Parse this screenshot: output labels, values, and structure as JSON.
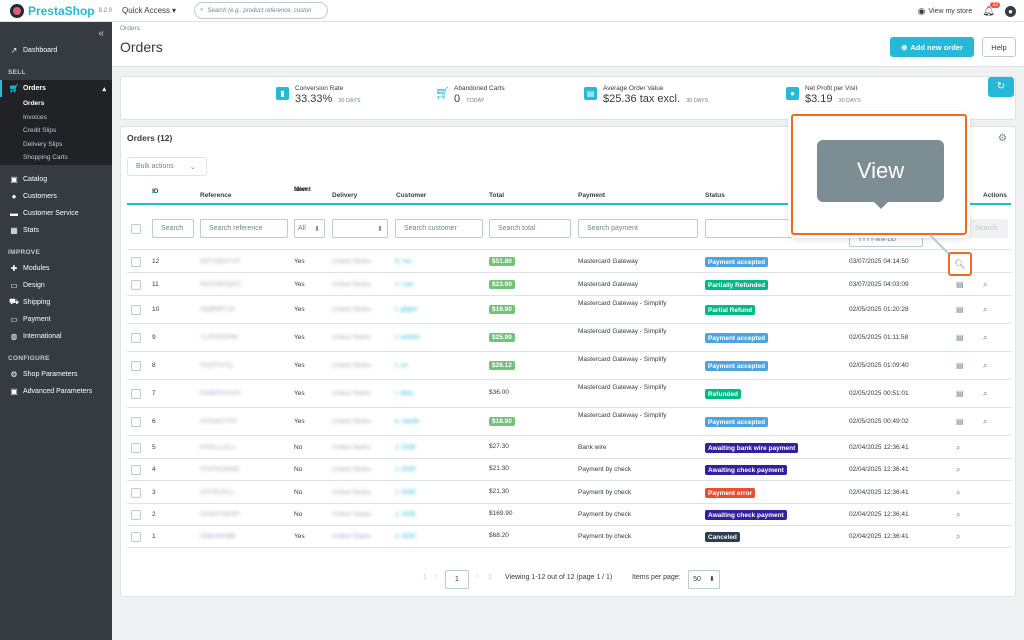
{
  "topbar": {
    "logo_text": "PrestaShop",
    "version": "8.2.0",
    "quick_access": "Quick Access",
    "search_placeholder": "Search (e.g.: product reference, custon",
    "view_store": "View my store",
    "notif_count": "22"
  },
  "sidebar": {
    "collapse_icon": "«",
    "dashboard": "Dashboard",
    "sections": {
      "sell": "SELL",
      "improve": "IMPROVE",
      "configure": "CONFIGURE"
    },
    "orders": "Orders",
    "orders_sub": [
      "Orders",
      "Invoices",
      "Credit Slips",
      "Delivery Slips",
      "Shopping Carts"
    ],
    "sell_items": [
      "Catalog",
      "Customers",
      "Customer Service",
      "Stats"
    ],
    "improve_items": [
      "Modules",
      "Design",
      "Shipping",
      "Payment",
      "International"
    ],
    "configure_items": [
      "Shop Parameters",
      "Advanced Parameters"
    ]
  },
  "header": {
    "breadcrumb": "Orders",
    "title": "Orders",
    "add_button": "Add new order",
    "help_button": "Help"
  },
  "kpis": [
    {
      "label": "Conversion Rate",
      "value": "33.33%",
      "period": "30 DAYS"
    },
    {
      "label": "Abandoned Carts",
      "value": "0",
      "period": "TODAY"
    },
    {
      "label": "Average Order Value",
      "value": "$25.36 tax excl.",
      "period": "30 DAYS"
    },
    {
      "label": "Net Profit per Visit",
      "value": "$3.19",
      "period": "30 DAYS"
    }
  ],
  "panel": {
    "title": "Orders (12)",
    "bulk_actions": "Bulk actions",
    "columns": [
      "ID",
      "Reference",
      "New",
      "client",
      "Delivery",
      "Customer",
      "Total",
      "Payment",
      "Status",
      "Actions"
    ],
    "filters": {
      "id": "Search",
      "reference": "Search reference",
      "new_client": "All",
      "customer": "Search customer",
      "total": "Search total",
      "payment": "Search payment",
      "date": "YYYY-MM-DD",
      "search_button": "Search"
    }
  },
  "rows": [
    {
      "id": "12",
      "ref": "WZTQBHYHT",
      "new": "Yes",
      "delivery": "United States",
      "customer": "S. Ivo",
      "total": "$51.80",
      "total_badge": true,
      "payment": "Mastercard Gateway",
      "payment2": "",
      "status": "Payment accepted",
      "status_color": "#4ea4df",
      "date": "03/07/2025 04:14:50",
      "invoice": false
    },
    {
      "id": "11",
      "ref": "INCGWOQEC",
      "new": "Yes",
      "delivery": "United States",
      "customer": "J. Lee",
      "total": "$23.90",
      "total_badge": true,
      "payment": "Mastercard Gateway",
      "payment2": "",
      "status": "Partially Refunded",
      "status_color": "#01b887",
      "date": "03/07/2025 04:03:09",
      "invoice": true
    },
    {
      "id": "10",
      "ref": "HQBRRTJA",
      "new": "Yes",
      "delivery": "United States",
      "customer": "I. gdgrd",
      "total": "$19.90",
      "total_badge": true,
      "payment": "Mastercard Gateway - Simplify",
      "payment2": "",
      "status": "Partial Refund",
      "status_color": "#01b887",
      "date": "02/05/2025 01:20:28",
      "invoice": true
    },
    {
      "id": "9",
      "ref": "YLIPZSOHM",
      "new": "Yes",
      "delivery": "United States",
      "customer": "I. wefdrd",
      "total": "$25.90",
      "total_badge": true,
      "payment": "Mastercard Gateway - Simplify",
      "payment2": "",
      "status": "Payment accepted",
      "status_color": "#4ea4df",
      "date": "02/05/2025 01:11:58",
      "invoice": true
    },
    {
      "id": "8",
      "ref": "FKQTHITQ",
      "new": "Yes",
      "delivery": "United States",
      "customer": "I. uri",
      "total": "$26.12",
      "total_badge": true,
      "payment": "Mastercard Gateway - Simplify",
      "payment2": "",
      "status": "Payment accepted",
      "status_color": "#4ea4df",
      "date": "02/05/2025 01:09:40",
      "invoice": true
    },
    {
      "id": "7",
      "ref": "EWBPHYKZK",
      "new": "Yes",
      "delivery": "United States",
      "customer": "I. ifdss",
      "total": "$36.00",
      "total_badge": false,
      "payment": "Mastercard Gateway - Simplify",
      "payment2": "",
      "status": "Refunded",
      "status_color": "#01b887",
      "date": "02/05/2025 00:51:01",
      "invoice": true
    },
    {
      "id": "6",
      "ref": "DXSWGTFP",
      "new": "Yes",
      "delivery": "United States",
      "customer": "e. wasfe",
      "total": "$18.90",
      "total_badge": true,
      "payment": "Mastercard Gateway - Simplify",
      "payment2": "",
      "status": "Payment accepted",
      "status_color": "#4ea4df",
      "date": "02/05/2025 00:49:02",
      "invoice": true
    },
    {
      "id": "5",
      "ref": "KHNLLLELL",
      "new": "No",
      "delivery": "United States",
      "customer": "J. DOE",
      "total": "$27.30",
      "total_badge": false,
      "payment": "Bank wire",
      "payment2": "",
      "status": "Awaiting bank wire payment",
      "status_color": "#34209e",
      "date": "02/04/2025 12:36:41",
      "invoice": false
    },
    {
      "id": "4",
      "ref": "FFATNOMNE",
      "new": "No",
      "delivery": "United States",
      "customer": "J. DOE",
      "total": "$21.30",
      "total_badge": false,
      "payment": "Payment by check",
      "payment2": "",
      "status": "Awaiting check payment",
      "status_color": "#34209e",
      "date": "02/04/2025 12:36:41",
      "invoice": false
    },
    {
      "id": "3",
      "ref": "UOYEVDLL",
      "new": "No",
      "delivery": "United States",
      "customer": "J. DOE",
      "total": "$21.30",
      "total_badge": false,
      "payment": "Payment by check",
      "payment2": "",
      "status": "Payment error",
      "status_color": "#e84e30",
      "date": "02/04/2025 12:36:41",
      "invoice": false
    },
    {
      "id": "2",
      "ref": "OHSATSERP",
      "new": "No",
      "delivery": "United States",
      "customer": "J. DOE",
      "total": "$169.90",
      "total_badge": false,
      "payment": "Payment by check",
      "payment2": "",
      "status": "Awaiting check payment",
      "status_color": "#34209e",
      "date": "02/04/2025 12:36;41",
      "invoice": false
    },
    {
      "id": "1",
      "ref": "XKBHNHBB",
      "new": "Yes",
      "delivery": "United States",
      "customer": "J. DOE",
      "total": "$68.20",
      "total_badge": false,
      "payment": "Payment by check",
      "payment2": "",
      "status": "Canceled",
      "status_color": "#2c3e50",
      "date": "02/04/2025 12:36:41",
      "invoice": false
    }
  ],
  "pagination": {
    "first": "1",
    "current": "1",
    "last": "1",
    "info": "Viewing 1-12 out of 12 (page 1 / 1)",
    "per_page_label": "Items per page:",
    "per_page": "50"
  },
  "callout": {
    "text": "View"
  },
  "colors": {
    "accent": "#25b9d7",
    "sidebar": "#363a41",
    "callout_border": "#f26a22"
  }
}
